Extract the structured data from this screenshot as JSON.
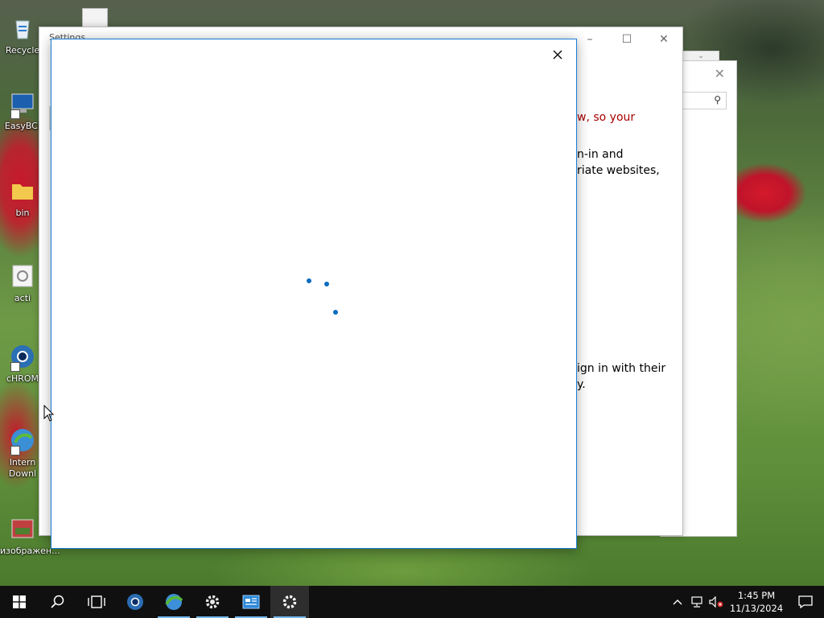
{
  "desktop": {
    "icons": [
      {
        "label": "Recycle"
      },
      {
        "label": "EasyBCI"
      },
      {
        "label": "bin"
      },
      {
        "label": "acti"
      },
      {
        "label": "cHROM"
      },
      {
        "label": "Intern Downl"
      },
      {
        "label": "изображен..."
      }
    ]
  },
  "settings_window": {
    "title": "Settings",
    "lines": [
      "w, so your",
      "n-in and",
      "riate websites,",
      "ign in with their",
      "y."
    ]
  },
  "taskbar": {
    "apps": [
      "start-button",
      "search-button",
      "task-view-button",
      "chrome-app",
      "download-manager-app",
      "control-gear-app",
      "mail-app",
      "settings-app"
    ],
    "clock_time": "1:45 PM",
    "clock_date": "11/13/2024"
  },
  "colors": {
    "accent": "#0b6cbf",
    "dialog_border": "#1a7cd6",
    "warning_text": "#a80000",
    "taskbar": "#101010"
  }
}
